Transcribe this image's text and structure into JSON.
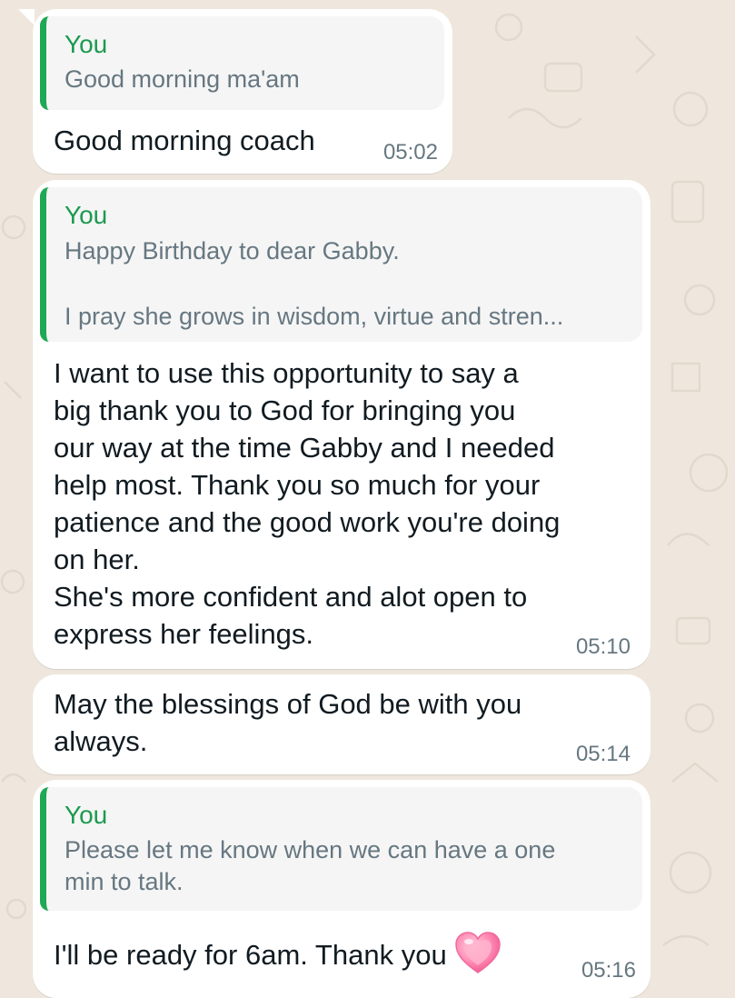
{
  "colors": {
    "wallpaper": "#efe7dd",
    "bubble": "#ffffff",
    "quote_bar": "#1fa855",
    "quote_author": "#1c9a4f",
    "quote_text": "#667781",
    "message_text": "#111b21"
  },
  "messages": [
    {
      "reply_to": {
        "author": "You",
        "text": "Good morning ma'am"
      },
      "text": "Good morning coach",
      "time": "05:02"
    },
    {
      "reply_to": {
        "author": "You",
        "text": "Happy Birthday to dear Gabby.\n\nI pray she grows in wisdom, virtue and stren..."
      },
      "text": "I want to use this opportunity to say a\nbig thank you to God for bringing you\nour way at the time Gabby and I needed\nhelp most. Thank you so much for your\npatience and the good work you're doing\non her.\nShe's more confident  and alot open to\nexpress her feelings.",
      "time": "05:10"
    },
    {
      "text": "May the blessings of God be with you\nalways.",
      "time": "05:14"
    },
    {
      "reply_to": {
        "author": "You",
        "text": "Please let me know when we can have a one\nmin to talk."
      },
      "text": "I'll be ready for 6am. Thank you",
      "emoji": "growing-heart",
      "time": "05:16"
    }
  ]
}
